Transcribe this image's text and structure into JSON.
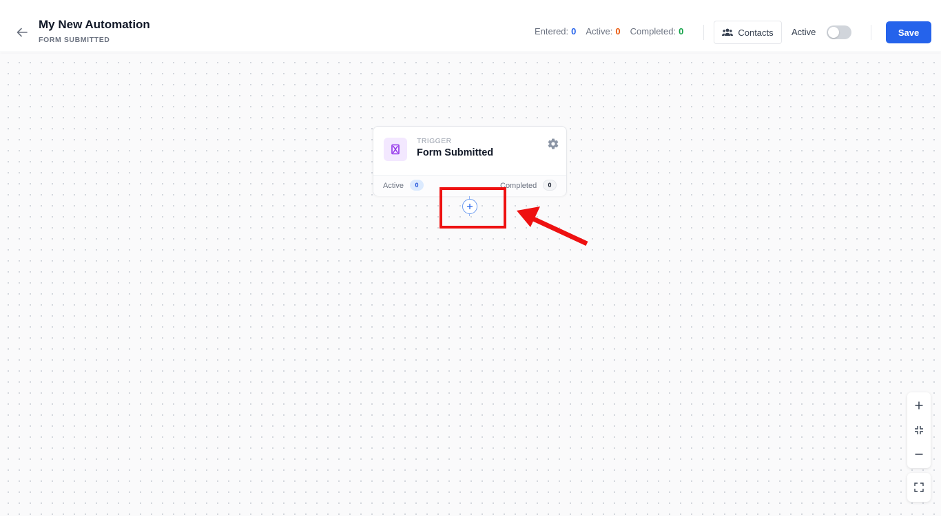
{
  "header": {
    "title": "My New Automation",
    "subtitle": "FORM SUBMITTED",
    "stats": {
      "entered_label": "Entered:",
      "entered_value": "0",
      "active_label": "Active:",
      "active_value": "0",
      "completed_label": "Completed:",
      "completed_value": "0"
    },
    "contacts_label": "Contacts",
    "active_toggle_label": "Active",
    "active_toggle_on": false,
    "save_label": "Save"
  },
  "trigger_node": {
    "type_label": "TRIGGER",
    "title": "Form Submitted",
    "footer": {
      "active_label": "Active",
      "active_count": "0",
      "completed_label": "Completed",
      "completed_count": "0"
    }
  },
  "colors": {
    "primary": "#2563eb",
    "entered": "#2563eb",
    "active": "#ea580c",
    "completed": "#16a34a",
    "annotation": "#ee1111",
    "trigger_icon_bg": "#f3e8ff",
    "trigger_icon": "#9333ea"
  },
  "icons": {
    "back": "arrow-left-icon",
    "contacts": "users-icon",
    "trigger": "hourglass-icon",
    "settings": "gear-icon",
    "add": "plus-circle-icon",
    "zoom_in": "plus-icon",
    "fit": "compress-icon",
    "zoom_out": "minus-icon",
    "fullscreen": "expand-icon"
  }
}
